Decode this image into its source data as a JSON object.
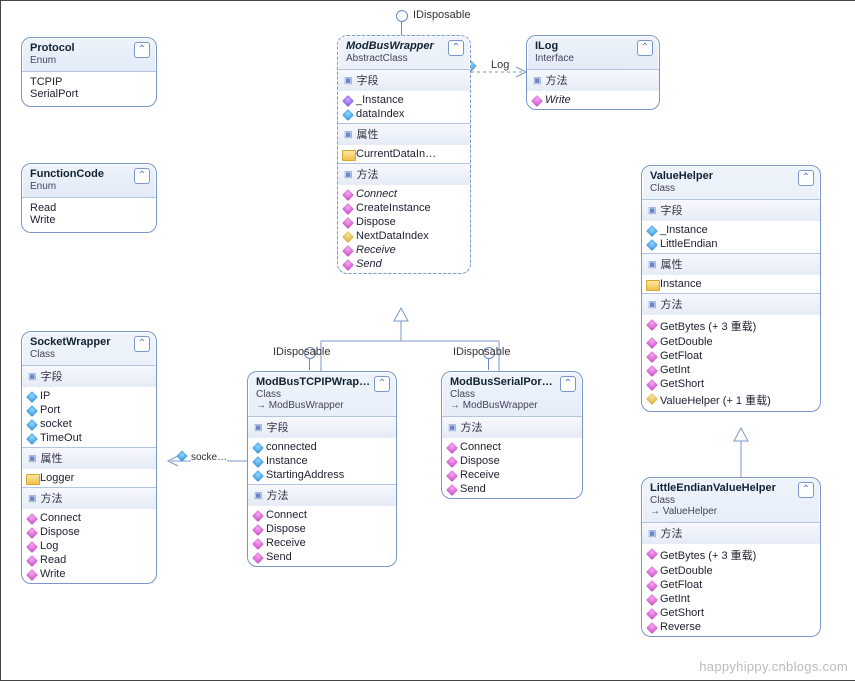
{
  "boxes": {
    "protocol": {
      "name": "Protocol",
      "kind": "Enum",
      "items": [
        "TCPIP",
        "SerialPort"
      ]
    },
    "functionCode": {
      "name": "FunctionCode",
      "kind": "Enum",
      "items": [
        "Read",
        "Write"
      ]
    },
    "modbusWrapper": {
      "name": "ModBusWrapper",
      "kind": "AbstractClass",
      "sections": {
        "fields": {
          "title": "字段",
          "items": [
            "_Instance",
            "dataIndex"
          ]
        },
        "props": {
          "title": "属性",
          "items": [
            "CurrentDataIn…"
          ]
        },
        "methods": {
          "title": "方法",
          "items": [
            {
              "t": "Connect",
              "i": "ital"
            },
            {
              "t": "CreateInstance"
            },
            {
              "t": "Dispose"
            },
            {
              "t": "NextDataIndex",
              "icon": "methodg"
            },
            {
              "t": "Receive",
              "i": "ital"
            },
            {
              "t": "Send",
              "i": "ital"
            }
          ]
        }
      }
    },
    "ilog": {
      "name": "ILog",
      "kind": "Interface",
      "sections": {
        "methods": {
          "title": "方法",
          "items": [
            {
              "t": "Write",
              "i": "ital"
            }
          ]
        }
      }
    },
    "valueHelper": {
      "name": "ValueHelper",
      "kind": "Class",
      "sections": {
        "fields": {
          "title": "字段",
          "items": [
            "_Instance",
            "LittleEndian"
          ]
        },
        "props": {
          "title": "属性",
          "items": [
            "Instance"
          ]
        },
        "methods": {
          "title": "方法",
          "items": [
            {
              "t": "GetBytes (+ 3 重载)"
            },
            {
              "t": "GetDouble"
            },
            {
              "t": "GetFloat"
            },
            {
              "t": "GetInt"
            },
            {
              "t": "GetShort"
            },
            {
              "t": "ValueHelper (+ 1 重载)",
              "icon": "methodg"
            }
          ]
        }
      }
    },
    "socketWrapper": {
      "name": "SocketWrapper",
      "kind": "Class",
      "sections": {
        "fields": {
          "title": "字段",
          "items": [
            "IP",
            "Port",
            "socket",
            "TimeOut"
          ]
        },
        "props": {
          "title": "属性",
          "items": [
            "Logger"
          ]
        },
        "methods": {
          "title": "方法",
          "items": [
            {
              "t": "Connect"
            },
            {
              "t": "Dispose"
            },
            {
              "t": "Log"
            },
            {
              "t": "Read"
            },
            {
              "t": "Write"
            }
          ]
        }
      }
    },
    "modbusTcp": {
      "name": "ModBusTCPIPWrap…",
      "kind": "Class",
      "base": "ModBusWrapper",
      "sections": {
        "fields": {
          "title": "字段",
          "items": [
            "connected",
            "Instance",
            "StartingAddress"
          ]
        },
        "methods": {
          "title": "方法",
          "items": [
            {
              "t": "Connect"
            },
            {
              "t": "Dispose"
            },
            {
              "t": "Receive"
            },
            {
              "t": "Send"
            }
          ]
        }
      }
    },
    "modbusSerial": {
      "name": "ModBusSerialPor…",
      "kind": "Class",
      "base": "ModBusWrapper",
      "sections": {
        "methods": {
          "title": "方法",
          "items": [
            {
              "t": "Connect"
            },
            {
              "t": "Dispose"
            },
            {
              "t": "Receive"
            },
            {
              "t": "Send"
            }
          ]
        }
      }
    },
    "littleEndian": {
      "name": "LittleEndianValueHelper",
      "kind": "Class",
      "base": "ValueHelper",
      "sections": {
        "methods": {
          "title": "方法",
          "items": [
            {
              "t": "GetBytes (+ 3 重载)"
            },
            {
              "t": "GetDouble"
            },
            {
              "t": "GetFloat"
            },
            {
              "t": "GetInt"
            },
            {
              "t": "GetShort"
            },
            {
              "t": "Reverse"
            }
          ]
        }
      }
    }
  },
  "labels": {
    "idisposable": "IDisposable",
    "log": "Log",
    "socketAssoc": "socke…"
  },
  "watermark": "happyhippy.cnblogs.com"
}
